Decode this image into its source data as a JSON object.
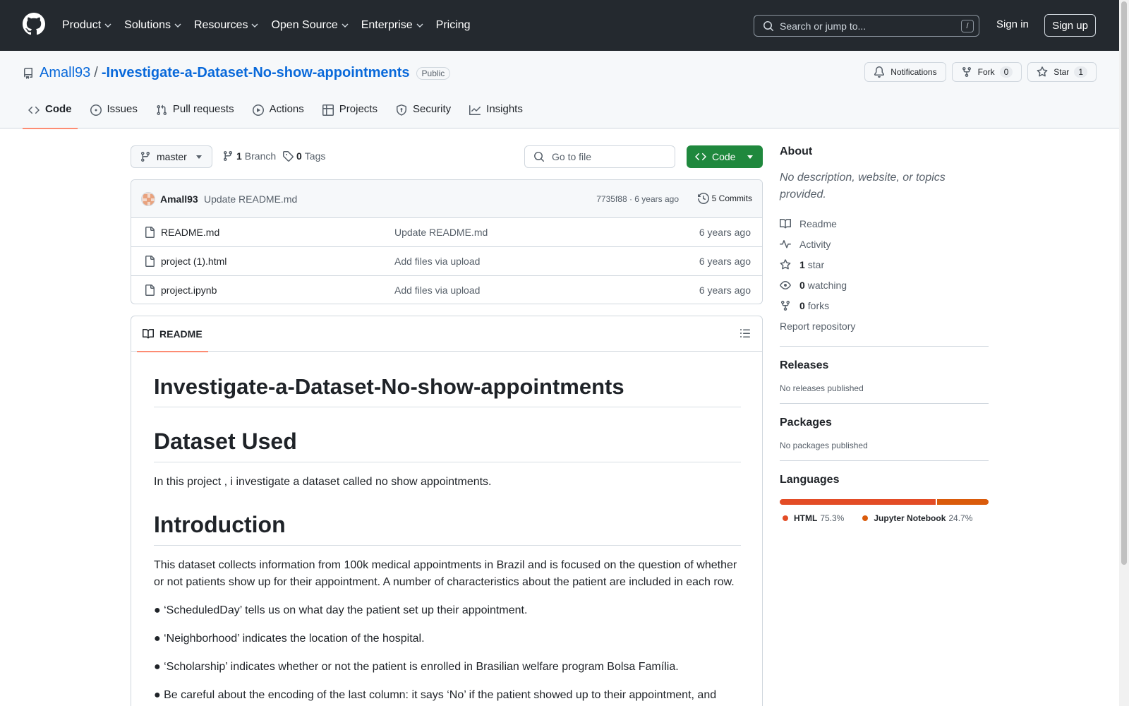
{
  "header": {
    "nav": [
      {
        "label": "Product",
        "has_menu": true
      },
      {
        "label": "Solutions",
        "has_menu": true
      },
      {
        "label": "Resources",
        "has_menu": true
      },
      {
        "label": "Open Source",
        "has_menu": true
      },
      {
        "label": "Enterprise",
        "has_menu": true
      },
      {
        "label": "Pricing",
        "has_menu": false
      }
    ],
    "search_placeholder": "Search or jump to...",
    "search_shortcut": "/",
    "signin": "Sign in",
    "signup": "Sign up"
  },
  "repo": {
    "owner": "Amall93",
    "separator": "/",
    "name": "-Investigate-a-Dataset-No-show-appointments",
    "visibility": "Public",
    "notifications_label": "Notifications",
    "fork_label": "Fork",
    "fork_count": "0",
    "star_label": "Star",
    "star_count": "1"
  },
  "tabs": [
    {
      "label": "Code",
      "icon": "code-icon",
      "active": true
    },
    {
      "label": "Issues",
      "icon": "issue-icon",
      "active": false
    },
    {
      "label": "Pull requests",
      "icon": "pull-request-icon",
      "active": false
    },
    {
      "label": "Actions",
      "icon": "play-icon",
      "active": false
    },
    {
      "label": "Projects",
      "icon": "table-icon",
      "active": false
    },
    {
      "label": "Security",
      "icon": "shield-icon",
      "active": false
    },
    {
      "label": "Insights",
      "icon": "graph-icon",
      "active": false
    }
  ],
  "toolbar": {
    "branch": "master",
    "branch_count": "1",
    "branch_label": "Branch",
    "tag_count": "0",
    "tag_label": "Tags",
    "goto_placeholder": "Go to file",
    "code_label": "Code"
  },
  "commit": {
    "author": "Amall93",
    "message": "Update README.md",
    "hash_time": "7735f88 · 6 years ago",
    "count_label": "5 Commits"
  },
  "files": [
    {
      "name": "README.md",
      "message": "Update README.md",
      "age": "6 years ago"
    },
    {
      "name": "project (1).html",
      "message": "Add files via upload",
      "age": "6 years ago"
    },
    {
      "name": "project.ipynb",
      "message": "Add files via upload",
      "age": "6 years ago"
    }
  ],
  "readme": {
    "tab_label": "README",
    "title": "Investigate-a-Dataset-No-show-appointments",
    "h_dataset": "Dataset Used",
    "p_dataset": "In this project , i investigate a dataset called no show appointments.",
    "h_intro": "Introduction",
    "p_intro": "This dataset collects information from 100k medical appointments in Brazil and is focused on the question of whether or not patients show up for their appointment. A number of characteristics about the patient are included in each row.",
    "bullet1": "● ‘ScheduledDay’ tells us on what day the patient set up their appointment.",
    "bullet2": "● ‘Neighborhood’ indicates the location of the hospital.",
    "bullet3": "● ‘Scholarship’ indicates whether or not the patient is enrolled in Brasilian welfare program Bolsa Família.",
    "bullet4": "● Be careful about the encoding of the last column: it says ‘No’ if the patient showed up to their appointment, and ‘Yes’ if they did not show up."
  },
  "sidebar": {
    "about_title": "About",
    "about_desc": "No description, website, or topics provided.",
    "readme_link": "Readme",
    "activity_link": "Activity",
    "stars_count": "1",
    "stars_label": "star",
    "watching_count": "0",
    "watching_label": "watching",
    "forks_count": "0",
    "forks_label": "forks",
    "report_link": "Report repository",
    "releases_title": "Releases",
    "releases_text": "No releases published",
    "packages_title": "Packages",
    "packages_text": "No packages published",
    "languages_title": "Languages",
    "languages": [
      {
        "name": "HTML",
        "percent": "75.3%",
        "fraction": 0.753,
        "color": "#e34c26"
      },
      {
        "name": "Jupyter Notebook",
        "percent": "24.7%",
        "fraction": 0.247,
        "color": "#da5b0b"
      }
    ]
  },
  "colors": {
    "header_bg": "#24292f",
    "link_blue": "#0969da",
    "primary_green": "#1f883d",
    "active_tab_underline": "#fd8c73"
  }
}
